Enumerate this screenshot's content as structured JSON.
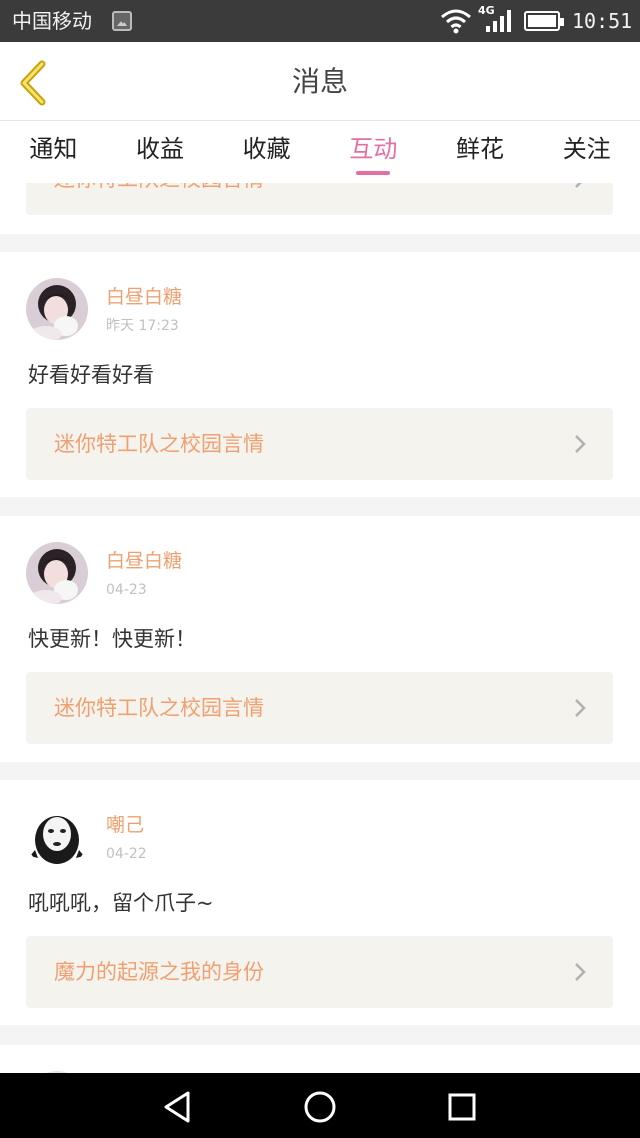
{
  "status_bar": {
    "carrier": "中国移动",
    "network": "4G",
    "time": "10:51"
  },
  "header": {
    "title": "消息"
  },
  "tabs": [
    {
      "label": "通知"
    },
    {
      "label": "收益"
    },
    {
      "label": "收藏"
    },
    {
      "label": "互动",
      "active": true
    },
    {
      "label": "鲜花"
    },
    {
      "label": "关注"
    }
  ],
  "top_card": {
    "link": "迷你特工队之校园言情"
  },
  "comments": [
    {
      "username": "白昼白糖",
      "time": "昨天 17:23",
      "text": "好看好看好看",
      "link": "迷你特工队之校园言情"
    },
    {
      "username": "白昼白糖",
      "time": "04-23",
      "text": "快更新！快更新！",
      "link": "迷你特工队之校园言情"
    },
    {
      "username": "嘲己",
      "time": "04-22",
      "text": "吼吼吼，留个爪子~",
      "link": "魔力的起源之我的身份"
    }
  ],
  "colors": {
    "accent": "#e56fa3",
    "username": "#f0a070",
    "link_bg": "#f4f3ee"
  }
}
